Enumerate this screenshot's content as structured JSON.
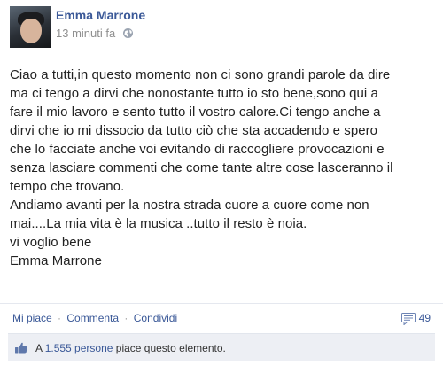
{
  "post": {
    "author": "Emma Marrone",
    "timestamp": "13 minuti fa",
    "privacy_icon": "globe-icon",
    "body_lines": [
      "Ciao a tutti,in questo momento non ci sono grandi parole da dire",
      "ma ci tengo a dirvi che nonostante tutto io sto bene,sono qui a",
      "fare il mio lavoro e sento tutto il vostro calore.Ci tengo anche a",
      "dirvi che io mi dissocio da tutto ciò che sta accadendo e spero",
      "che lo facciate anche voi evitando di raccogliere provocazioni e",
      "senza lasciare commenti che come tante altre cose lasceranno il",
      "tempo che trovano.",
      "Andiamo avanti per la nostra strada cuore a cuore come non",
      "mai....La mia vita è la musica ..tutto il resto è noia.",
      "vi voglio bene",
      "Emma Marrone"
    ]
  },
  "actions": {
    "like": "Mi piace",
    "comment": "Commenta",
    "share": "Condividi",
    "separator": "·",
    "comments_count": "49"
  },
  "likes": {
    "prefix": "A",
    "count_people": "1.555 persone",
    "suffix": "piace questo elemento."
  },
  "colors": {
    "link": "#3b5998",
    "likes_bg": "#edeff4"
  }
}
